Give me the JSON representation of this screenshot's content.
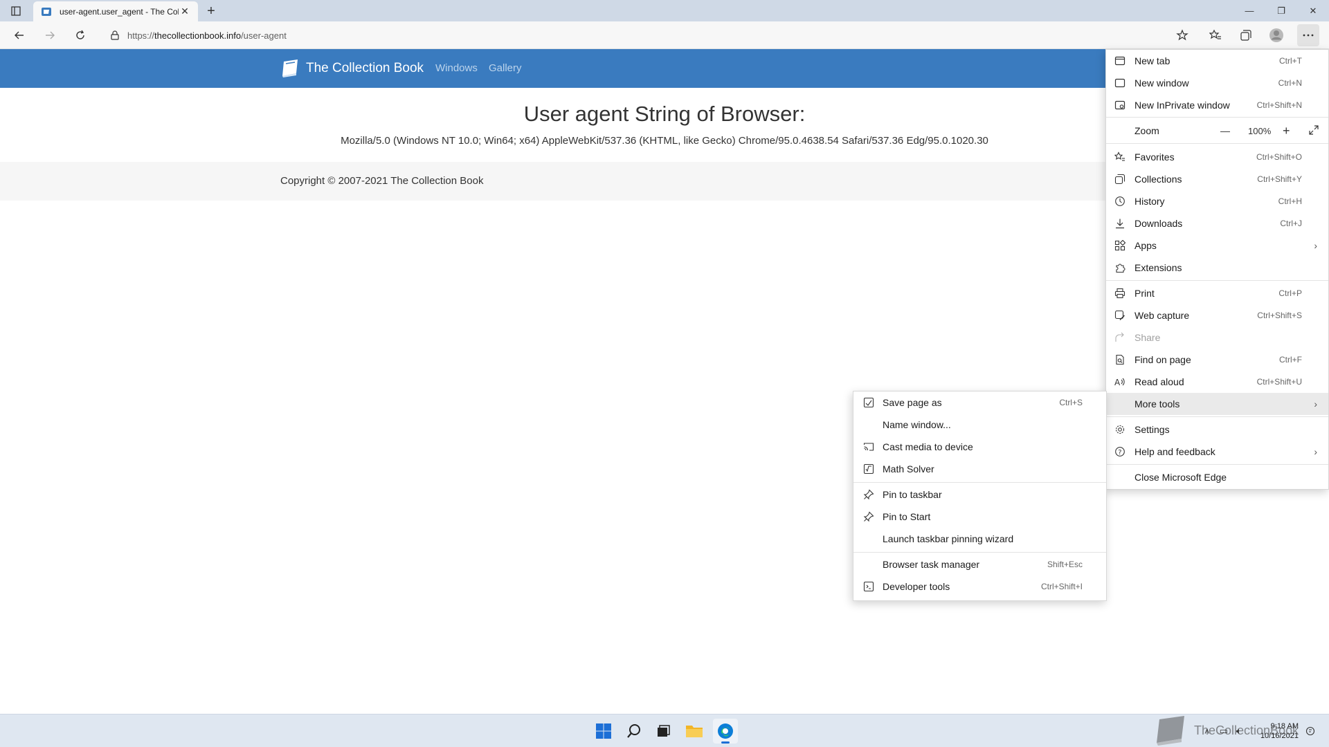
{
  "browser": {
    "tab": {
      "title": "user-agent.user_agent - The Coll",
      "close": "✕"
    },
    "new_tab": "+",
    "window_controls": {
      "minimize": "—",
      "maximize": "❐",
      "close": "✕"
    },
    "url": {
      "scheme": "https://",
      "host": "thecollectionbook.info",
      "path": "/user-agent"
    }
  },
  "site": {
    "brand": "The Collection Book",
    "nav": [
      "Windows",
      "Gallery"
    ],
    "heading": "User agent String of Browser:",
    "user_agent": "Mozilla/5.0 (Windows NT 10.0; Win64; x64) AppleWebKit/537.36 (KHTML, like Gecko) Chrome/95.0.4638.54 Safari/537.36 Edg/95.0.1020.30",
    "footer": "Copyright © 2007-2021 The Collection Book"
  },
  "menu": {
    "new_tab": {
      "label": "New tab",
      "shortcut": "Ctrl+T"
    },
    "new_window": {
      "label": "New window",
      "shortcut": "Ctrl+N"
    },
    "inprivate": {
      "label": "New InPrivate window",
      "shortcut": "Ctrl+Shift+N"
    },
    "zoom": {
      "label": "Zoom",
      "value": "100%",
      "minus": "—",
      "plus": "+"
    },
    "favorites": {
      "label": "Favorites",
      "shortcut": "Ctrl+Shift+O"
    },
    "collections": {
      "label": "Collections",
      "shortcut": "Ctrl+Shift+Y"
    },
    "history": {
      "label": "History",
      "shortcut": "Ctrl+H"
    },
    "downloads": {
      "label": "Downloads",
      "shortcut": "Ctrl+J"
    },
    "apps": {
      "label": "Apps"
    },
    "extensions": {
      "label": "Extensions"
    },
    "print": {
      "label": "Print",
      "shortcut": "Ctrl+P"
    },
    "web_capture": {
      "label": "Web capture",
      "shortcut": "Ctrl+Shift+S"
    },
    "share": {
      "label": "Share"
    },
    "find": {
      "label": "Find on page",
      "shortcut": "Ctrl+F"
    },
    "read_aloud": {
      "label": "Read aloud",
      "shortcut": "Ctrl+Shift+U"
    },
    "more_tools": {
      "label": "More tools"
    },
    "settings": {
      "label": "Settings"
    },
    "help": {
      "label": "Help and feedback"
    },
    "close_edge": {
      "label": "Close Microsoft Edge"
    }
  },
  "more_tools": {
    "save_page": {
      "label": "Save page as",
      "shortcut": "Ctrl+S"
    },
    "name_window": {
      "label": "Name window..."
    },
    "cast": {
      "label": "Cast media to device"
    },
    "math_solver": {
      "label": "Math Solver"
    },
    "pin_taskbar": {
      "label": "Pin to taskbar"
    },
    "pin_start": {
      "label": "Pin to Start"
    },
    "pin_wizard": {
      "label": "Launch taskbar pinning wizard"
    },
    "task_manager": {
      "label": "Browser task manager",
      "shortcut": "Shift+Esc"
    },
    "dev_tools": {
      "label": "Developer tools",
      "shortcut": "Ctrl+Shift+I"
    }
  },
  "taskbar": {
    "time": "9:18 AM",
    "date": "10/16/2021",
    "watermark": "TheCollectionBook"
  },
  "colors": {
    "site_header": "#3a7bbf",
    "tabbar": "#cfd9e6",
    "taskbar": "#dfe7f1",
    "accent": "#1d6fd6"
  }
}
